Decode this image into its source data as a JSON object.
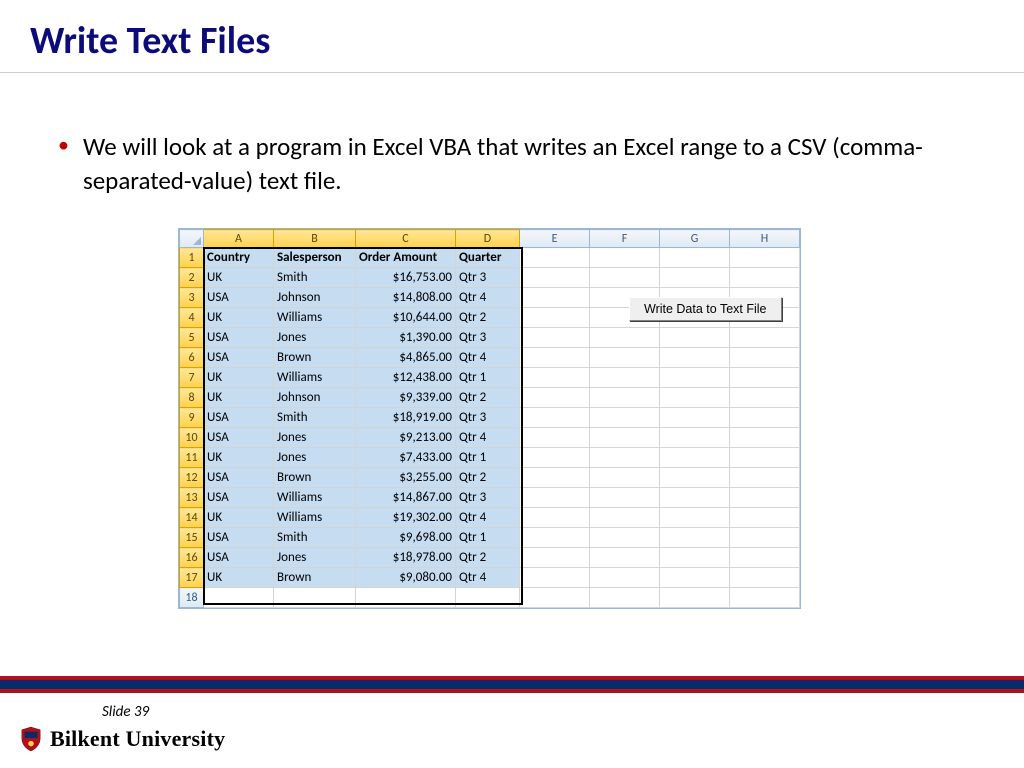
{
  "title": "Write Text Files",
  "bullet": "We will look at a program in Excel VBA that writes an Excel range to a CSV (comma-separated-value) text file.",
  "button_label": "Write Data to Text File",
  "columns": [
    "A",
    "B",
    "C",
    "D",
    "E",
    "F",
    "G",
    "H"
  ],
  "headers": {
    "c1": "Country",
    "c2": "Salesperson",
    "c3": "Order Amount",
    "c4": "Quarter"
  },
  "rows": [
    {
      "n": "1"
    },
    {
      "n": "2",
      "c1": "UK",
      "c2": "Smith",
      "c3": "$16,753.00",
      "c4": "Qtr 3"
    },
    {
      "n": "3",
      "c1": "USA",
      "c2": "Johnson",
      "c3": "$14,808.00",
      "c4": "Qtr 4"
    },
    {
      "n": "4",
      "c1": "UK",
      "c2": "Williams",
      "c3": "$10,644.00",
      "c4": "Qtr 2"
    },
    {
      "n": "5",
      "c1": "USA",
      "c2": "Jones",
      "c3": "$1,390.00",
      "c4": "Qtr 3"
    },
    {
      "n": "6",
      "c1": "USA",
      "c2": "Brown",
      "c3": "$4,865.00",
      "c4": "Qtr 4"
    },
    {
      "n": "7",
      "c1": "UK",
      "c2": "Williams",
      "c3": "$12,438.00",
      "c4": "Qtr 1"
    },
    {
      "n": "8",
      "c1": "UK",
      "c2": "Johnson",
      "c3": "$9,339.00",
      "c4": "Qtr 2"
    },
    {
      "n": "9",
      "c1": "USA",
      "c2": "Smith",
      "c3": "$18,919.00",
      "c4": "Qtr 3"
    },
    {
      "n": "10",
      "c1": "USA",
      "c2": "Jones",
      "c3": "$9,213.00",
      "c4": "Qtr 4"
    },
    {
      "n": "11",
      "c1": "UK",
      "c2": "Jones",
      "c3": "$7,433.00",
      "c4": "Qtr 1"
    },
    {
      "n": "12",
      "c1": "USA",
      "c2": "Brown",
      "c3": "$3,255.00",
      "c4": "Qtr 2"
    },
    {
      "n": "13",
      "c1": "USA",
      "c2": "Williams",
      "c3": "$14,867.00",
      "c4": "Qtr 3"
    },
    {
      "n": "14",
      "c1": "UK",
      "c2": "Williams",
      "c3": "$19,302.00",
      "c4": "Qtr 4"
    },
    {
      "n": "15",
      "c1": "USA",
      "c2": "Smith",
      "c3": "$9,698.00",
      "c4": "Qtr 1"
    },
    {
      "n": "16",
      "c1": "USA",
      "c2": "Jones",
      "c3": "$18,978.00",
      "c4": "Qtr 2"
    },
    {
      "n": "17",
      "c1": "UK",
      "c2": "Brown",
      "c3": "$9,080.00",
      "c4": "Qtr 4"
    },
    {
      "n": "18"
    }
  ],
  "slide_number": "Slide 39",
  "university": "Bilkent University"
}
